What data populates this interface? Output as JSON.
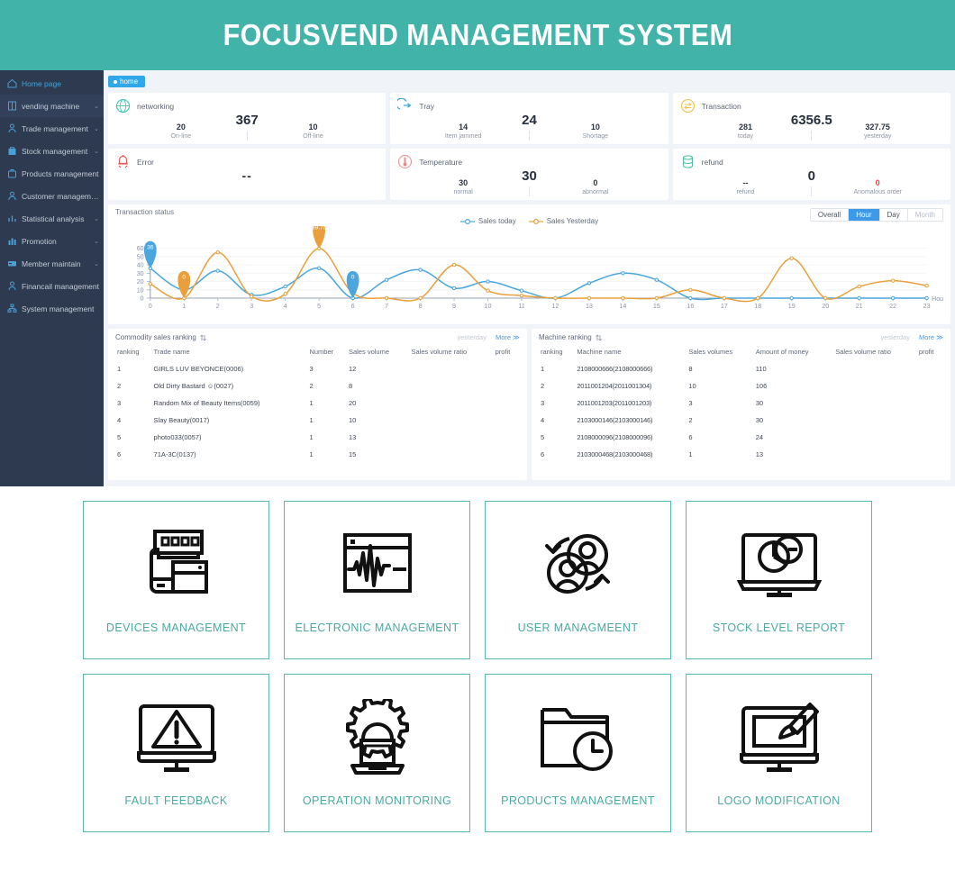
{
  "header": {
    "title": "FOCUSVEND MANAGEMENT SYSTEM",
    "bg": "#41b3a9"
  },
  "tab": {
    "label": "home"
  },
  "sidebar": {
    "items": [
      {
        "label": "Home page",
        "icon": "home-icon",
        "caret": "",
        "active": true
      },
      {
        "label": "vending machine",
        "icon": "machine-icon",
        "caret": "⌄",
        "active": false
      },
      {
        "label": "Trade management",
        "icon": "trade-icon",
        "caret": "⌄",
        "active": false
      },
      {
        "label": "Stock management",
        "icon": "stock-icon",
        "caret": "⌄",
        "active": false
      },
      {
        "label": "Products management",
        "icon": "products-icon",
        "caret": "",
        "active": false
      },
      {
        "label": "Customer management",
        "icon": "customer-icon",
        "caret": "",
        "active": false
      },
      {
        "label": "Statistical analysis",
        "icon": "chart-icon",
        "caret": "⌄",
        "active": false
      },
      {
        "label": "Promotion",
        "icon": "promotion-icon",
        "caret": "⌄",
        "active": false
      },
      {
        "label": "Member maintain",
        "icon": "member-icon",
        "caret": "⌄",
        "active": false
      },
      {
        "label": "Financail management",
        "icon": "finance-icon",
        "caret": "",
        "active": false
      },
      {
        "label": "System management",
        "icon": "system-icon",
        "caret": "",
        "active": false
      }
    ]
  },
  "stats": [
    {
      "name": "networking",
      "icon": "globe-icon",
      "color": "#3ec9b0",
      "main": "367",
      "cols": [
        {
          "value": "20",
          "label": "On-line"
        },
        {
          "value": "10",
          "label": "Off-line"
        }
      ]
    },
    {
      "name": "Tray",
      "icon": "tray-icon",
      "color": "#35a8e0",
      "main": "24",
      "cols": [
        {
          "value": "14",
          "label": "Item jammed"
        },
        {
          "value": "10",
          "label": "Shortage"
        }
      ]
    },
    {
      "name": "Transaction",
      "icon": "transaction-icon",
      "color": "#f0c24b",
      "main": "6356.5",
      "cols": [
        {
          "value": "281",
          "label": "today"
        },
        {
          "value": "327.75",
          "label": "yesterday"
        }
      ]
    },
    {
      "name": "Error",
      "icon": "error-icon",
      "color": "#ee5a52",
      "main": "--",
      "cols": []
    },
    {
      "name": "Temperature",
      "icon": "temperature-icon",
      "color": "#f08a8a",
      "main": "30",
      "cols": [
        {
          "value": "30",
          "label": "normal"
        },
        {
          "value": "0",
          "label": "abnormal"
        }
      ]
    },
    {
      "name": "refund",
      "icon": "refund-icon",
      "color": "#4cc0a0",
      "main": "0",
      "cols": [
        {
          "value": "--",
          "label": "refund"
        },
        {
          "value": "0",
          "label": "Anomalous order",
          "red": true
        }
      ]
    }
  ],
  "chart_panel": {
    "title": "Transaction status",
    "range_buttons": [
      {
        "label": "Overall",
        "active": false,
        "disabled": false
      },
      {
        "label": "Hour",
        "active": true,
        "disabled": false
      },
      {
        "label": "Day",
        "active": false,
        "disabled": false
      },
      {
        "label": "Month",
        "active": false,
        "disabled": true
      }
    ],
    "axis_unit": "Hou"
  },
  "chart_data": {
    "type": "line",
    "title": "Transaction status",
    "xlabel": "Hou",
    "ylabel": "",
    "x": [
      0,
      1,
      2,
      3,
      4,
      5,
      6,
      7,
      8,
      9,
      10,
      11,
      12,
      13,
      14,
      15,
      16,
      17,
      18,
      19,
      20,
      21,
      22,
      23
    ],
    "xticks": [
      "0",
      "1",
      "2",
      "3",
      "4",
      "5",
      "6",
      "7",
      "8",
      "9",
      "10",
      "11",
      "12",
      "13",
      "14",
      "15",
      "16",
      "17",
      "18",
      "19",
      "20",
      "21",
      "22",
      "23"
    ],
    "yticks": [
      "0",
      "10",
      "20",
      "30",
      "40",
      "50",
      "60"
    ],
    "ylim": [
      0,
      65
    ],
    "grid": true,
    "legend": [
      "Sales today",
      "Sales Yesterday"
    ],
    "legend_position": "top-center",
    "colors": {
      "today": "#4aa6dd",
      "yesterday": "#e9a03c"
    },
    "series": [
      {
        "name": "Sales today",
        "color": "#4aa6dd",
        "values": [
          36,
          10,
          33,
          4,
          14,
          36,
          0,
          22,
          34,
          12,
          20,
          9,
          0,
          18,
          30,
          22,
          0,
          0,
          0,
          0,
          0,
          0,
          0,
          0
        ],
        "labels": [
          {
            "x": 0,
            "value": "36"
          },
          {
            "x": 6,
            "value": "0"
          }
        ]
      },
      {
        "name": "Sales Yesterday",
        "color": "#e9a03c",
        "values": [
          17,
          0,
          55,
          2,
          5,
          59.75,
          6,
          0,
          0,
          40,
          9,
          3,
          0,
          0,
          0,
          0,
          10,
          0,
          0,
          48,
          0,
          14,
          21,
          15
        ],
        "labels": [
          {
            "x": 1,
            "value": "0"
          },
          {
            "x": 5,
            "value": "59.75"
          }
        ]
      }
    ]
  },
  "commodity_ranking": {
    "title": "Commodity sales ranking",
    "period": "yesterday",
    "more": "More ≫",
    "columns": [
      "ranking",
      "Trade name",
      "Number",
      "Sales volume",
      "Sales volume ratio",
      "profit"
    ],
    "rows": [
      {
        "ranking": "1",
        "name": "GIRLS LUV BEYONCE(0006)",
        "number": "3",
        "volume": "12",
        "ratio": "",
        "profit": ""
      },
      {
        "ranking": "2",
        "name": "Old Dirty Bastard ☺(0027)",
        "number": "2",
        "volume": "8",
        "ratio": "",
        "profit": ""
      },
      {
        "ranking": "3",
        "name": "Random Mix of Beauty Items(0059)",
        "number": "1",
        "volume": "20",
        "ratio": "",
        "profit": ""
      },
      {
        "ranking": "4",
        "name": "Slay Beauty(0017)",
        "number": "1",
        "volume": "10",
        "ratio": "",
        "profit": ""
      },
      {
        "ranking": "5",
        "name": "photo033(0057)",
        "number": "1",
        "volume": "13",
        "ratio": "",
        "profit": ""
      },
      {
        "ranking": "6",
        "name": "71A-3C(0137)",
        "number": "1",
        "volume": "15",
        "ratio": "",
        "profit": ""
      }
    ]
  },
  "machine_ranking": {
    "title": "Machine ranking",
    "period": "yesterday",
    "more": "More ≫",
    "columns": [
      "ranking",
      "Machine name",
      "Sales volumes",
      "Amount of money",
      "Sales volume ratio",
      "profit"
    ],
    "rows": [
      {
        "ranking": "1",
        "name": "2108000666(2108000666)",
        "volumes": "8",
        "money": "110",
        "ratio": "",
        "profit": ""
      },
      {
        "ranking": "2",
        "name": "2011001204(2011001304)",
        "volumes": "10",
        "money": "106",
        "ratio": "",
        "profit": ""
      },
      {
        "ranking": "3",
        "name": "2011001203(2011001203)",
        "volumes": "3",
        "money": "30",
        "ratio": "",
        "profit": ""
      },
      {
        "ranking": "4",
        "name": "2103000146(2103000146)",
        "volumes": "2",
        "money": "30",
        "ratio": "",
        "profit": ""
      },
      {
        "ranking": "5",
        "name": "2108000096(2108000096)",
        "volumes": "6",
        "money": "24",
        "ratio": "",
        "profit": ""
      },
      {
        "ranking": "6",
        "name": "2103000468(2103000468)",
        "volumes": "1",
        "money": "13",
        "ratio": "",
        "profit": ""
      }
    ]
  },
  "features": {
    "border_color": "#59b8b0",
    "label_color": "#4aa9a2",
    "cards": [
      {
        "label": "DEVICES MANAGEMENT",
        "icon": "devices-icon"
      },
      {
        "label": "ELECTRONIC MANAGEMENT",
        "icon": "waveform-window-icon"
      },
      {
        "label": "USER MANAGMEENT",
        "icon": "users-refresh-icon"
      },
      {
        "label": "STOCK LEVEL REPORT",
        "icon": "monitor-piechart-icon"
      },
      {
        "label": "FAULT FEEDBACK",
        "icon": "monitor-warning-icon"
      },
      {
        "label": "OPERATION MONITORING",
        "icon": "gear-laptop-icon"
      },
      {
        "label": "PRODUCTS MANAGEMENT",
        "icon": "folder-clock-icon"
      },
      {
        "label": "LOGO MODIFICATION",
        "icon": "monitor-brush-icon"
      }
    ]
  }
}
